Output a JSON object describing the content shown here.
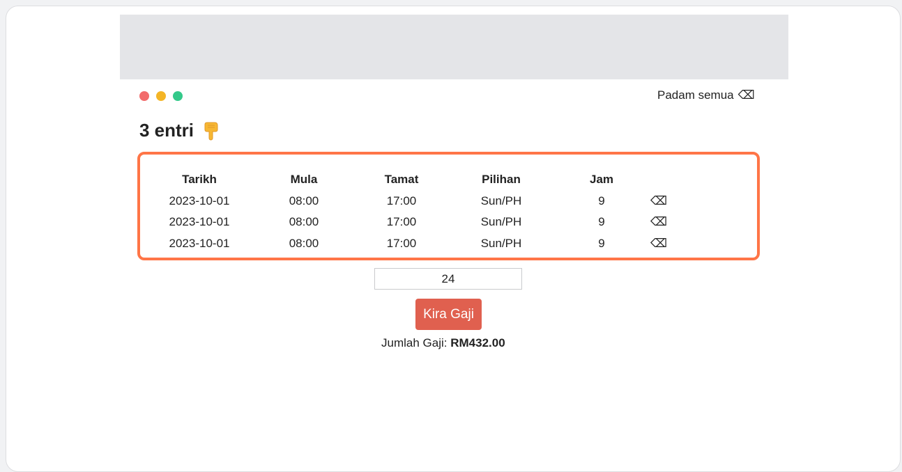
{
  "window": {
    "dots": [
      {
        "name": "close",
        "color": "#f26b6b"
      },
      {
        "name": "minimize",
        "color": "#f4b526"
      },
      {
        "name": "maximize",
        "color": "#34c98a"
      }
    ]
  },
  "header": {
    "clear_all_label": "Padam semua",
    "clear_all_icon": "⌫",
    "title": "3 entri",
    "title_icon": "backhand-index-pointing-down-icon"
  },
  "table": {
    "border_color": "#ff7547",
    "columns": [
      "Tarikh",
      "Mula",
      "Tamat",
      "Pilihan",
      "Jam"
    ],
    "rows": [
      {
        "date": "2023-10-01",
        "start": "08:00",
        "end": "17:00",
        "option": "Sun/PH",
        "hours": "9",
        "delete_icon": "⌫"
      },
      {
        "date": "2023-10-01",
        "start": "08:00",
        "end": "17:00",
        "option": "Sun/PH",
        "hours": "9",
        "delete_icon": "⌫"
      },
      {
        "date": "2023-10-01",
        "start": "08:00",
        "end": "17:00",
        "option": "Sun/PH",
        "hours": "9",
        "delete_icon": "⌫"
      }
    ]
  },
  "form": {
    "rate_value": "24",
    "calculate_label": "Kira Gaji",
    "calculate_color": "#e0604f"
  },
  "result": {
    "label": "Jumlah Gaji:",
    "value": "RM432.00"
  }
}
